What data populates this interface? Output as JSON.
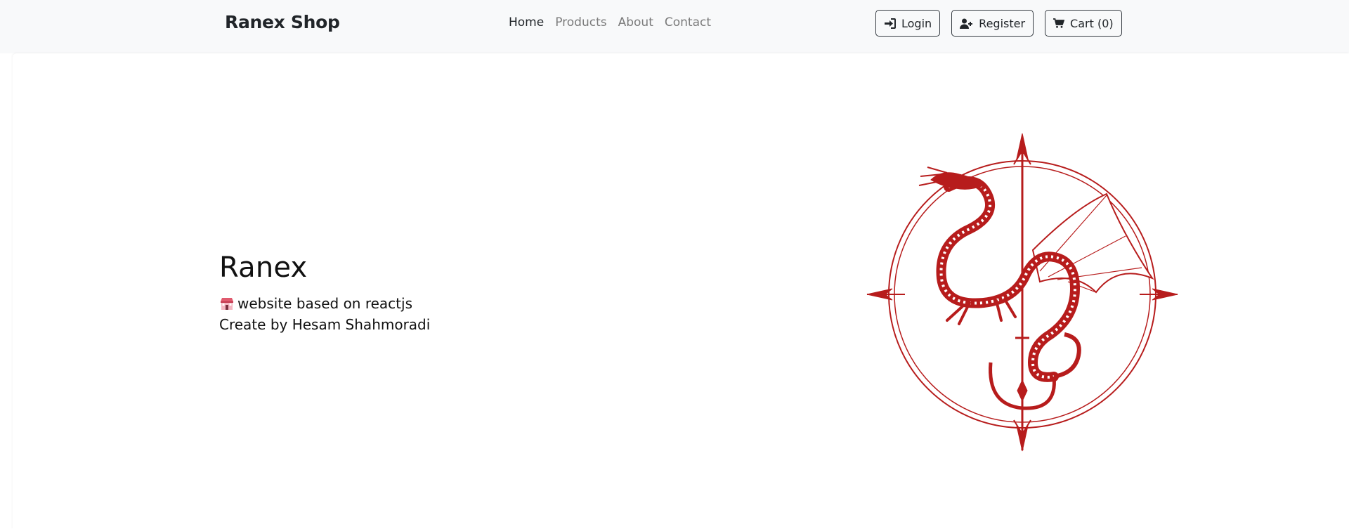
{
  "navbar": {
    "brand": "Ranex Shop",
    "links": [
      {
        "label": "Home",
        "active": true
      },
      {
        "label": "Products",
        "active": false
      },
      {
        "label": "About",
        "active": false
      },
      {
        "label": "Contact",
        "active": false
      }
    ],
    "buttons": {
      "login": {
        "label": "Login",
        "icon": "sign-in-icon"
      },
      "register": {
        "label": "Register",
        "icon": "user-plus-icon"
      },
      "cart": {
        "label": "Cart (0)",
        "icon": "shopping-cart-icon"
      }
    }
  },
  "hero": {
    "title": "Ranex",
    "line1_icon": "store-emoji-icon",
    "line1": "website based on reactjs",
    "line2": "Create by Hesam Shahmoradi"
  },
  "colors": {
    "navbar_bg": "#f8f9fa",
    "accent_red": "#b71c1c",
    "text_dark": "#212529",
    "text_muted": "#7a7a7a"
  }
}
